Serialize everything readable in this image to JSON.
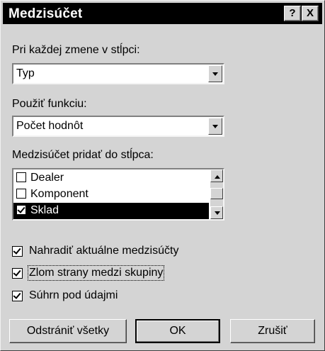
{
  "dialog": {
    "title": "Medzisúčet",
    "help_label": "?",
    "close_label": "X"
  },
  "group_by": {
    "label": "Pri každej zmene v stĺpci:",
    "value": "Typ"
  },
  "function": {
    "label": "Použiť funkciu:",
    "value": "Počet hodnôt"
  },
  "add_to": {
    "label": "Medzisúčet pridať do stĺpca:",
    "items": [
      {
        "label": "Dealer",
        "checked": false,
        "selected": false
      },
      {
        "label": "Komponent",
        "checked": false,
        "selected": false
      },
      {
        "label": "Sklad",
        "checked": true,
        "selected": true
      }
    ]
  },
  "options": [
    {
      "label": "Nahradiť aktuálne medzisúčty",
      "checked": true
    },
    {
      "label": "Zlom strany medzi skupiny",
      "checked": true
    },
    {
      "label": "Súhrn pod údajmi",
      "checked": true
    }
  ],
  "buttons": {
    "remove_all": "Odstrániť všetky",
    "ok": "OK",
    "cancel": "Zrušiť"
  }
}
